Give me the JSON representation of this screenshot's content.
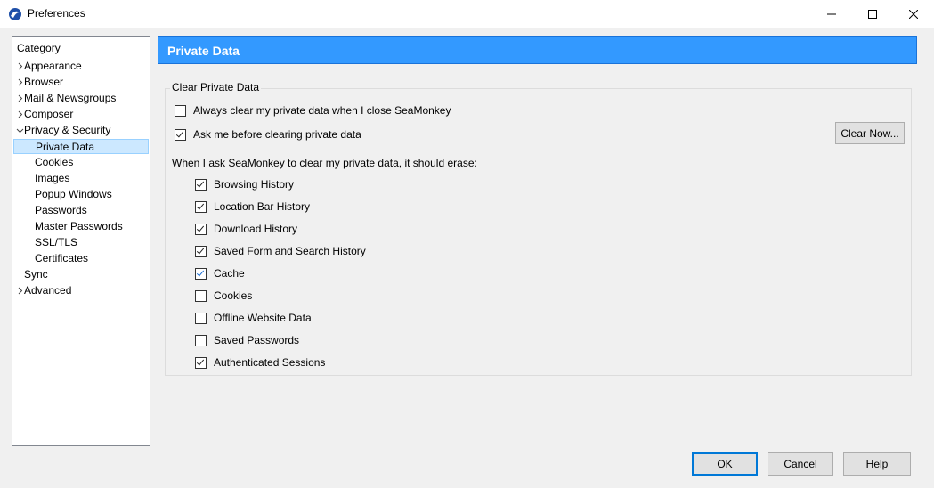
{
  "window": {
    "title": "Preferences",
    "controls": {
      "minimize": "minimize-icon",
      "maximize": "maximize-icon",
      "close": "close-icon"
    }
  },
  "sidebar": {
    "header": "Category",
    "items": [
      {
        "label": "Appearance",
        "level": 0,
        "expander": "collapsed"
      },
      {
        "label": "Browser",
        "level": 0,
        "expander": "collapsed"
      },
      {
        "label": "Mail & Newsgroups",
        "level": 0,
        "expander": "collapsed"
      },
      {
        "label": "Composer",
        "level": 0,
        "expander": "collapsed"
      },
      {
        "label": "Privacy & Security",
        "level": 0,
        "expander": "expanded"
      },
      {
        "label": "Private Data",
        "level": 1,
        "selected": true
      },
      {
        "label": "Cookies",
        "level": 1
      },
      {
        "label": "Images",
        "level": 1
      },
      {
        "label": "Popup Windows",
        "level": 1
      },
      {
        "label": "Passwords",
        "level": 1
      },
      {
        "label": "Master Passwords",
        "level": 1
      },
      {
        "label": "SSL/TLS",
        "level": 1
      },
      {
        "label": "Certificates",
        "level": 1
      },
      {
        "label": "Sync",
        "level": 0,
        "expander": "none"
      },
      {
        "label": "Advanced",
        "level": 0,
        "expander": "collapsed"
      }
    ]
  },
  "panel": {
    "title": "Private Data",
    "group_title": "Clear Private Data",
    "always_clear": {
      "label": "Always clear my private data when I close SeaMonkey",
      "checked": false
    },
    "ask_before": {
      "label": "Ask me before clearing private data",
      "checked": true
    },
    "clear_now_label": "Clear Now...",
    "erase_intro": "When I ask SeaMonkey to clear my private data, it should erase:",
    "erase_items": [
      {
        "label": "Browsing History",
        "checked": true
      },
      {
        "label": "Location Bar History",
        "checked": true
      },
      {
        "label": "Download History",
        "checked": true
      },
      {
        "label": "Saved Form and Search History",
        "checked": true
      },
      {
        "label": "Cache",
        "checked": true
      },
      {
        "label": "Cookies",
        "checked": false
      },
      {
        "label": "Offline Website Data",
        "checked": false
      },
      {
        "label": "Saved Passwords",
        "checked": false
      },
      {
        "label": "Authenticated Sessions",
        "checked": true
      }
    ]
  },
  "footer": {
    "ok_label": "OK",
    "cancel_label": "Cancel",
    "help_label": "Help"
  },
  "colors": {
    "header_blue": "#3399ff",
    "selection": "#cce8ff",
    "default_button_border": "#0078d7"
  }
}
